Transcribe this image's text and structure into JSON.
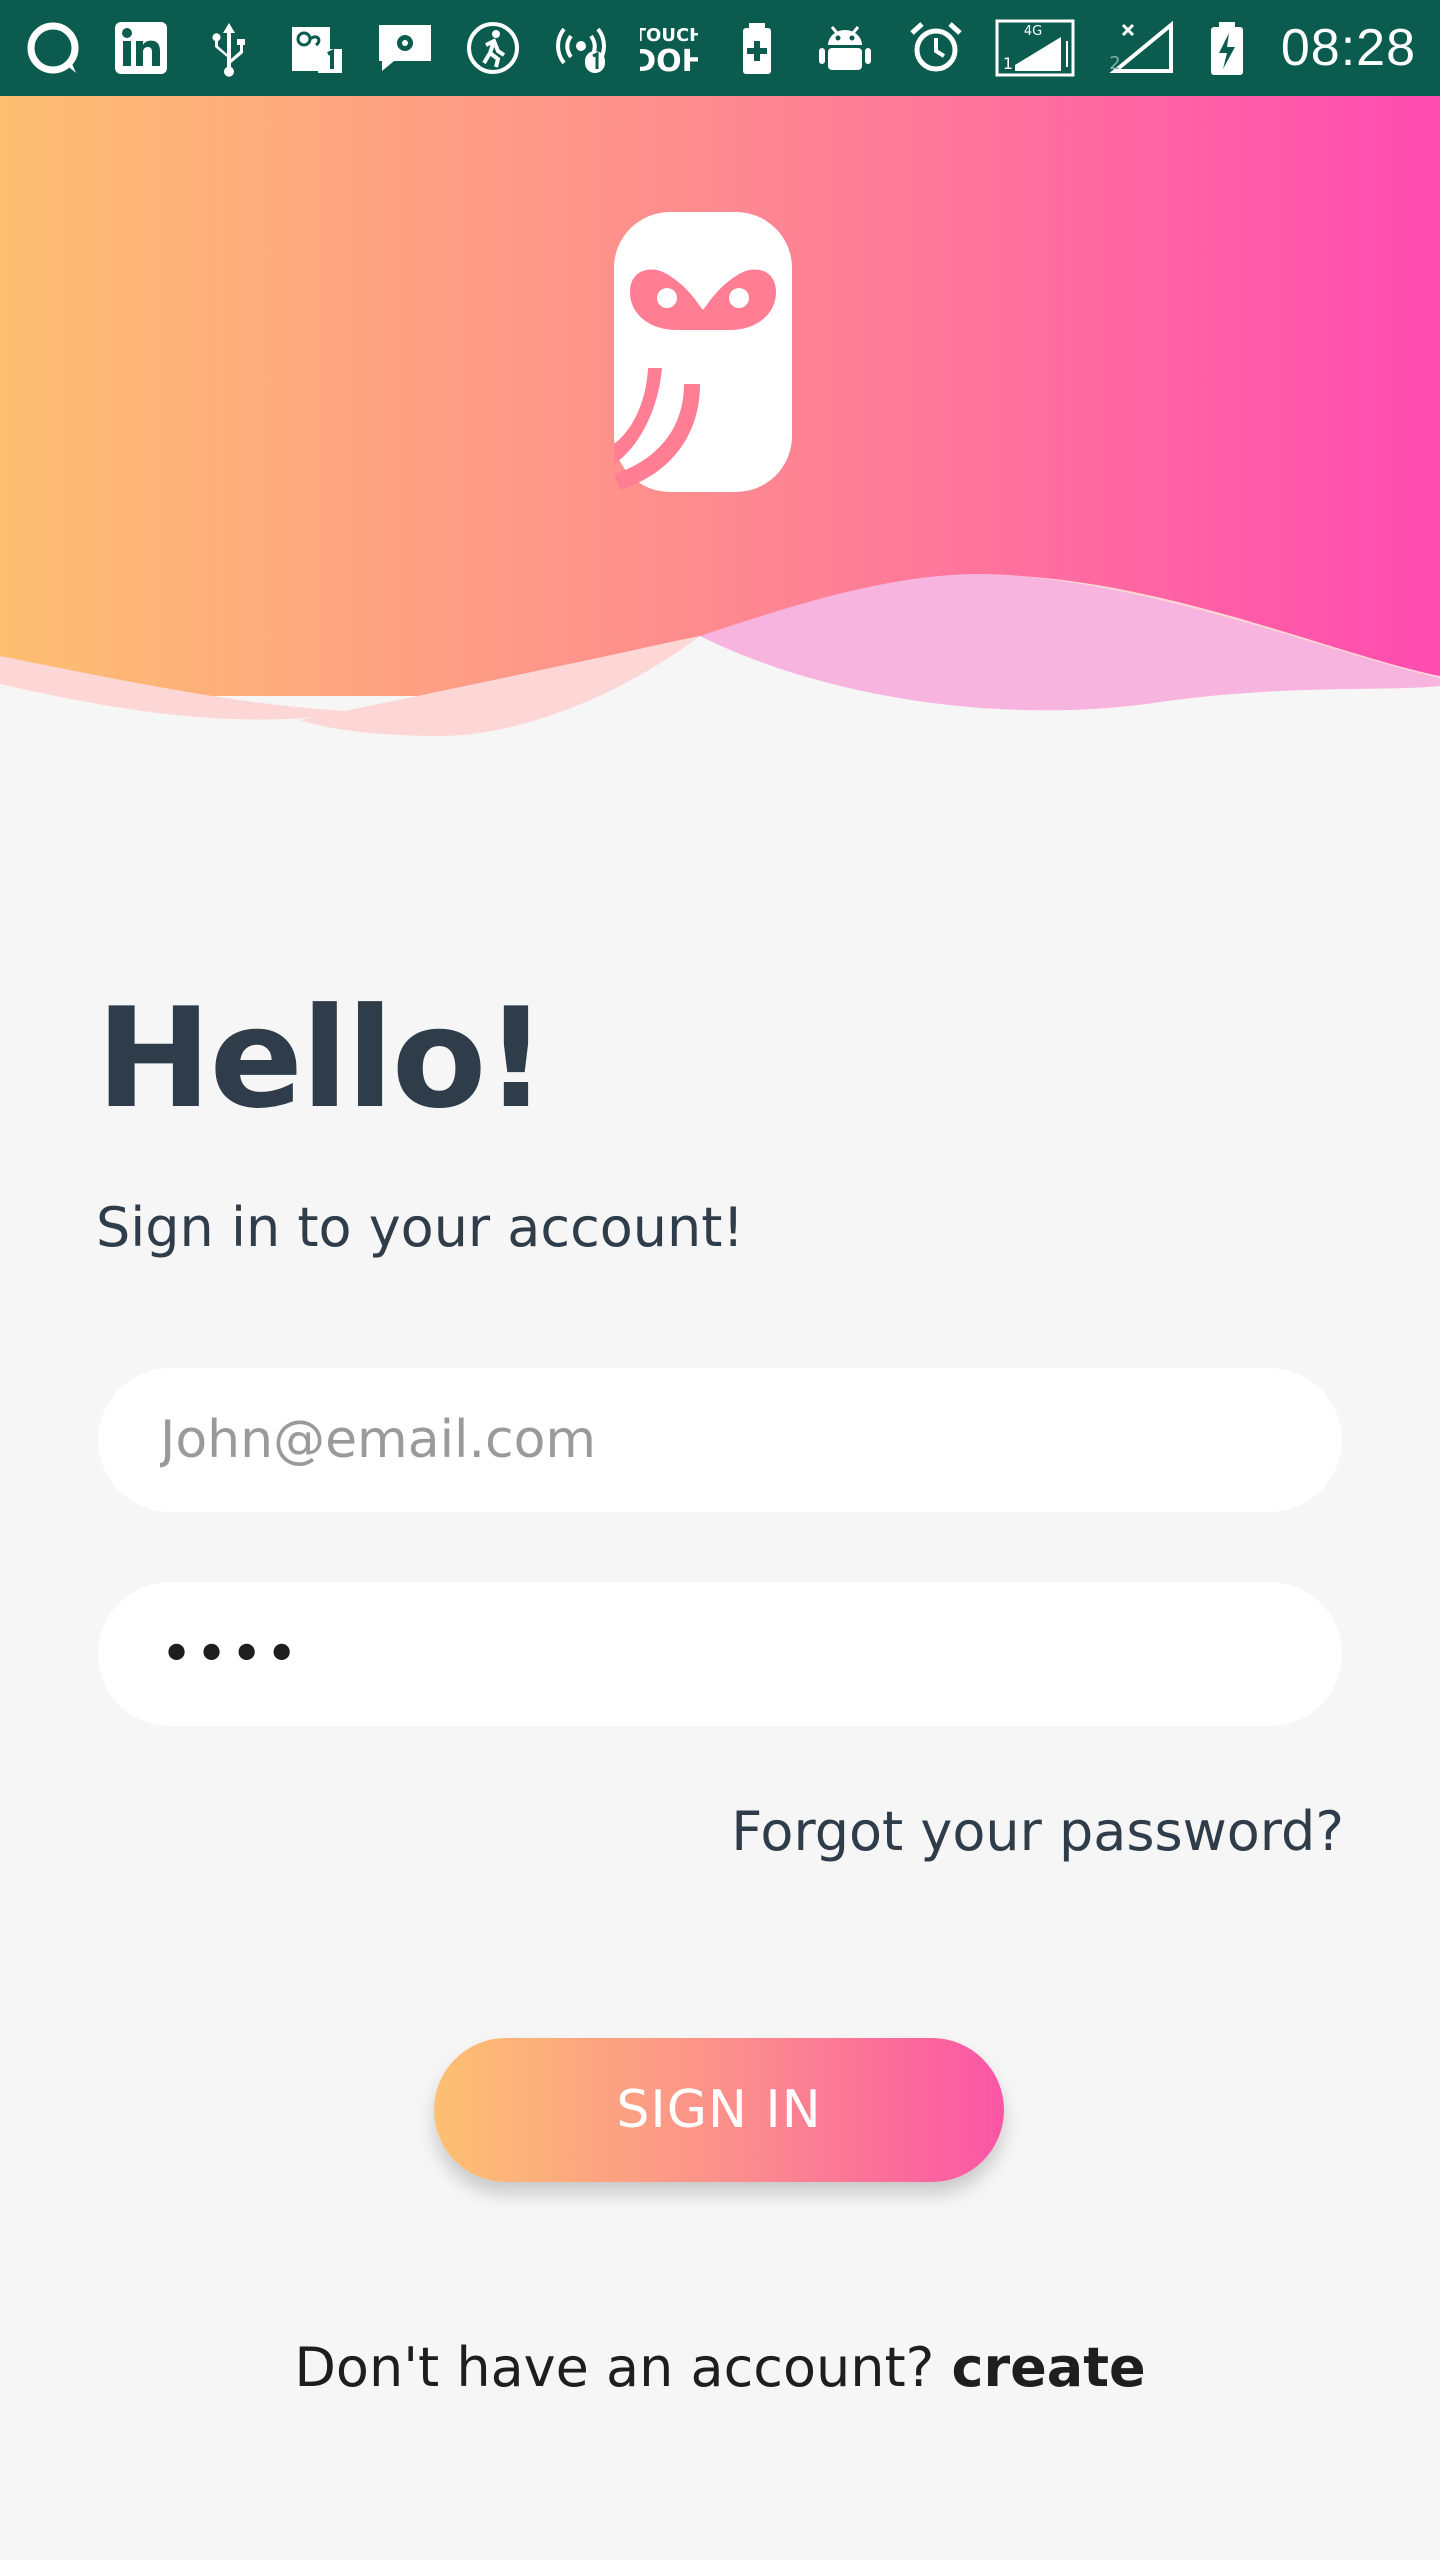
{
  "status_bar": {
    "time": "08:28",
    "left_icons": [
      "chat-icon",
      "linkedin-icon",
      "usb-icon",
      "notification-1-icon",
      "settings-message-icon",
      "activity-icon",
      "hotspot-icon",
      "touch-doh-icon",
      "battery-plus-icon",
      "android-icon"
    ],
    "right_icons": [
      "alarm-icon",
      "signal-4g-sim1-icon",
      "signal-sim2-icon",
      "battery-charging-icon"
    ],
    "background_color": "#0b5b4f"
  },
  "header": {
    "gradient_colors": [
      "#fdbf71",
      "#fe8a90",
      "#ff4bb0"
    ]
  },
  "main": {
    "heading": "Hello!",
    "subtitle": "Sign in to your account!",
    "email_placeholder": "John@email.com",
    "password_value": "••••",
    "forgot_link": "Forgot your password?",
    "signin_button": "SIGN IN"
  },
  "footer": {
    "prompt": "Don't have an account?",
    "create_link": "create"
  },
  "colors": {
    "text_dark": "#2f3d4a",
    "background": "#f6f6f6",
    "button_gradient_start": "#fdc072",
    "button_gradient_end": "#fb55a6"
  }
}
